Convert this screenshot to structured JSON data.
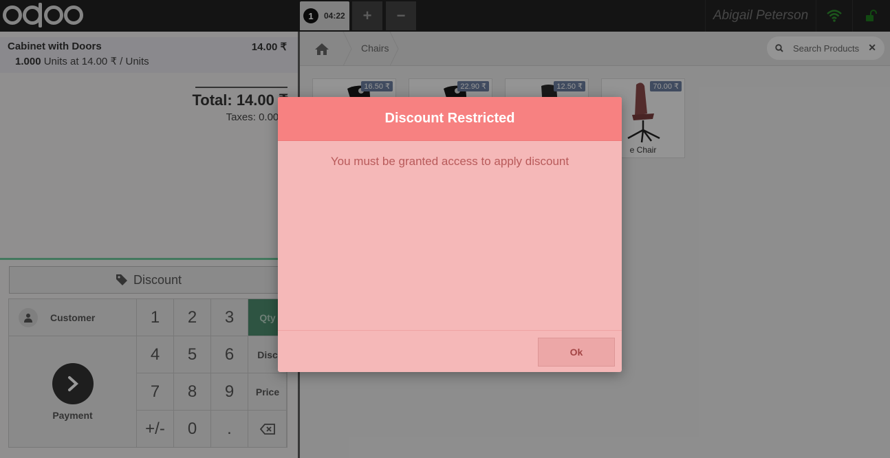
{
  "topbar": {
    "order_number": "1",
    "order_time": "04:22",
    "add_label": "+",
    "remove_label": "−",
    "user_name": "Abigail Peterson"
  },
  "orderline": {
    "product": "Cabinet with Doors",
    "price": "14.00 ₹",
    "qty": "1.000",
    "unit_text": "Units at 14.00 ₹ / Units"
  },
  "summary": {
    "total": "Total: 14.00 ₹",
    "taxes": "Taxes: 0.00 ₹"
  },
  "controls": {
    "discount_label": "Discount",
    "customer_label": "Customer",
    "payment_label": "Payment"
  },
  "numpad": {
    "k1": "1",
    "k2": "2",
    "k3": "3",
    "k4": "4",
    "k5": "5",
    "k6": "6",
    "k7": "7",
    "k8": "8",
    "k9": "9",
    "kplusminus": "+/-",
    "k0": "0",
    "kdot": ".",
    "qty": "Qty",
    "disc": "Disc",
    "price": "Price"
  },
  "catalog": {
    "breadcrumb": "Chairs",
    "search_placeholder": "Search Products",
    "products": [
      {
        "price": "16.50 ₹",
        "name": ""
      },
      {
        "price": "22.90 ₹",
        "name": ""
      },
      {
        "price": "12.50 ₹",
        "name": ""
      },
      {
        "price": "70.00 ₹",
        "name": "e Chair"
      }
    ]
  },
  "dialog": {
    "title": "Discount Restricted",
    "message": "You must be granted access to apply discount",
    "ok_label": "Ok"
  },
  "colors": {
    "accent_green": "#6ec89b",
    "dialog_header": "#f78181",
    "dialog_body": "#f5b8b8"
  }
}
